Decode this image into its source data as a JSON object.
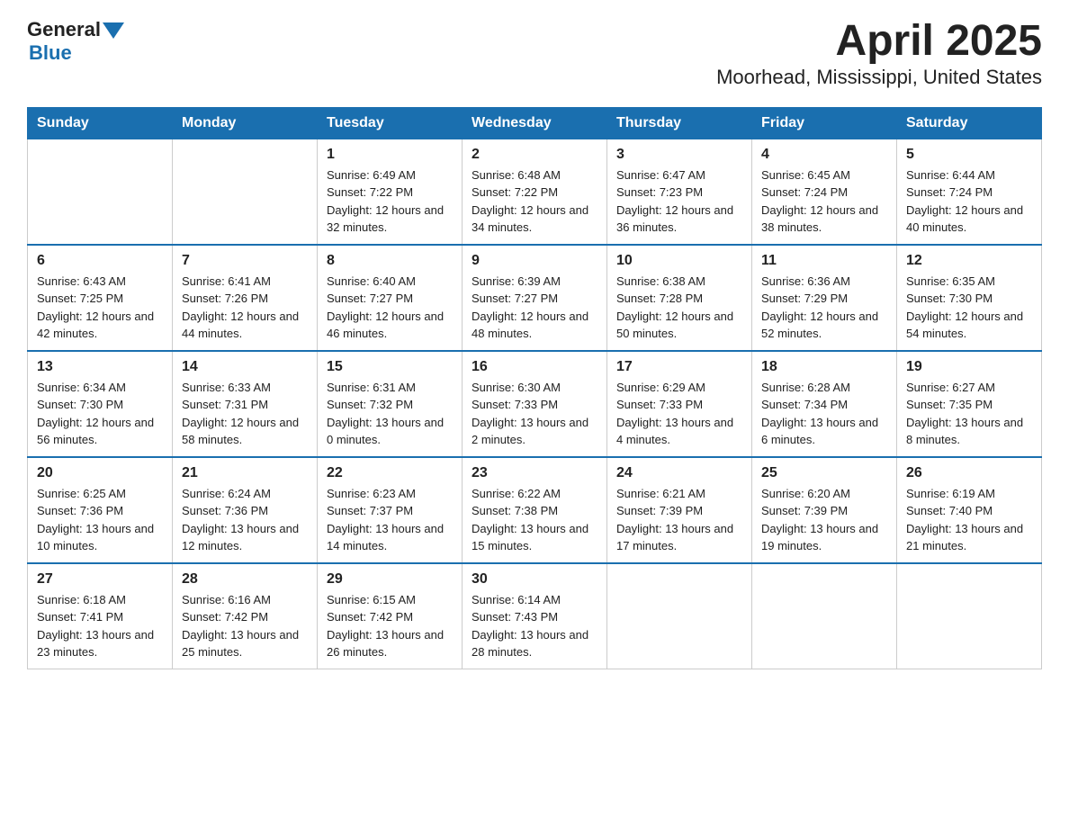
{
  "header": {
    "logo_general": "General",
    "logo_blue": "Blue",
    "title": "April 2025",
    "subtitle": "Moorhead, Mississippi, United States"
  },
  "calendar": {
    "days_of_week": [
      "Sunday",
      "Monday",
      "Tuesday",
      "Wednesday",
      "Thursday",
      "Friday",
      "Saturday"
    ],
    "weeks": [
      [
        {
          "day": "",
          "info": ""
        },
        {
          "day": "",
          "info": ""
        },
        {
          "day": "1",
          "info": "Sunrise: 6:49 AM\nSunset: 7:22 PM\nDaylight: 12 hours\nand 32 minutes."
        },
        {
          "day": "2",
          "info": "Sunrise: 6:48 AM\nSunset: 7:22 PM\nDaylight: 12 hours\nand 34 minutes."
        },
        {
          "day": "3",
          "info": "Sunrise: 6:47 AM\nSunset: 7:23 PM\nDaylight: 12 hours\nand 36 minutes."
        },
        {
          "day": "4",
          "info": "Sunrise: 6:45 AM\nSunset: 7:24 PM\nDaylight: 12 hours\nand 38 minutes."
        },
        {
          "day": "5",
          "info": "Sunrise: 6:44 AM\nSunset: 7:24 PM\nDaylight: 12 hours\nand 40 minutes."
        }
      ],
      [
        {
          "day": "6",
          "info": "Sunrise: 6:43 AM\nSunset: 7:25 PM\nDaylight: 12 hours\nand 42 minutes."
        },
        {
          "day": "7",
          "info": "Sunrise: 6:41 AM\nSunset: 7:26 PM\nDaylight: 12 hours\nand 44 minutes."
        },
        {
          "day": "8",
          "info": "Sunrise: 6:40 AM\nSunset: 7:27 PM\nDaylight: 12 hours\nand 46 minutes."
        },
        {
          "day": "9",
          "info": "Sunrise: 6:39 AM\nSunset: 7:27 PM\nDaylight: 12 hours\nand 48 minutes."
        },
        {
          "day": "10",
          "info": "Sunrise: 6:38 AM\nSunset: 7:28 PM\nDaylight: 12 hours\nand 50 minutes."
        },
        {
          "day": "11",
          "info": "Sunrise: 6:36 AM\nSunset: 7:29 PM\nDaylight: 12 hours\nand 52 minutes."
        },
        {
          "day": "12",
          "info": "Sunrise: 6:35 AM\nSunset: 7:30 PM\nDaylight: 12 hours\nand 54 minutes."
        }
      ],
      [
        {
          "day": "13",
          "info": "Sunrise: 6:34 AM\nSunset: 7:30 PM\nDaylight: 12 hours\nand 56 minutes."
        },
        {
          "day": "14",
          "info": "Sunrise: 6:33 AM\nSunset: 7:31 PM\nDaylight: 12 hours\nand 58 minutes."
        },
        {
          "day": "15",
          "info": "Sunrise: 6:31 AM\nSunset: 7:32 PM\nDaylight: 13 hours\nand 0 minutes."
        },
        {
          "day": "16",
          "info": "Sunrise: 6:30 AM\nSunset: 7:33 PM\nDaylight: 13 hours\nand 2 minutes."
        },
        {
          "day": "17",
          "info": "Sunrise: 6:29 AM\nSunset: 7:33 PM\nDaylight: 13 hours\nand 4 minutes."
        },
        {
          "day": "18",
          "info": "Sunrise: 6:28 AM\nSunset: 7:34 PM\nDaylight: 13 hours\nand 6 minutes."
        },
        {
          "day": "19",
          "info": "Sunrise: 6:27 AM\nSunset: 7:35 PM\nDaylight: 13 hours\nand 8 minutes."
        }
      ],
      [
        {
          "day": "20",
          "info": "Sunrise: 6:25 AM\nSunset: 7:36 PM\nDaylight: 13 hours\nand 10 minutes."
        },
        {
          "day": "21",
          "info": "Sunrise: 6:24 AM\nSunset: 7:36 PM\nDaylight: 13 hours\nand 12 minutes."
        },
        {
          "day": "22",
          "info": "Sunrise: 6:23 AM\nSunset: 7:37 PM\nDaylight: 13 hours\nand 14 minutes."
        },
        {
          "day": "23",
          "info": "Sunrise: 6:22 AM\nSunset: 7:38 PM\nDaylight: 13 hours\nand 15 minutes."
        },
        {
          "day": "24",
          "info": "Sunrise: 6:21 AM\nSunset: 7:39 PM\nDaylight: 13 hours\nand 17 minutes."
        },
        {
          "day": "25",
          "info": "Sunrise: 6:20 AM\nSunset: 7:39 PM\nDaylight: 13 hours\nand 19 minutes."
        },
        {
          "day": "26",
          "info": "Sunrise: 6:19 AM\nSunset: 7:40 PM\nDaylight: 13 hours\nand 21 minutes."
        }
      ],
      [
        {
          "day": "27",
          "info": "Sunrise: 6:18 AM\nSunset: 7:41 PM\nDaylight: 13 hours\nand 23 minutes."
        },
        {
          "day": "28",
          "info": "Sunrise: 6:16 AM\nSunset: 7:42 PM\nDaylight: 13 hours\nand 25 minutes."
        },
        {
          "day": "29",
          "info": "Sunrise: 6:15 AM\nSunset: 7:42 PM\nDaylight: 13 hours\nand 26 minutes."
        },
        {
          "day": "30",
          "info": "Sunrise: 6:14 AM\nSunset: 7:43 PM\nDaylight: 13 hours\nand 28 minutes."
        },
        {
          "day": "",
          "info": ""
        },
        {
          "day": "",
          "info": ""
        },
        {
          "day": "",
          "info": ""
        }
      ]
    ]
  }
}
